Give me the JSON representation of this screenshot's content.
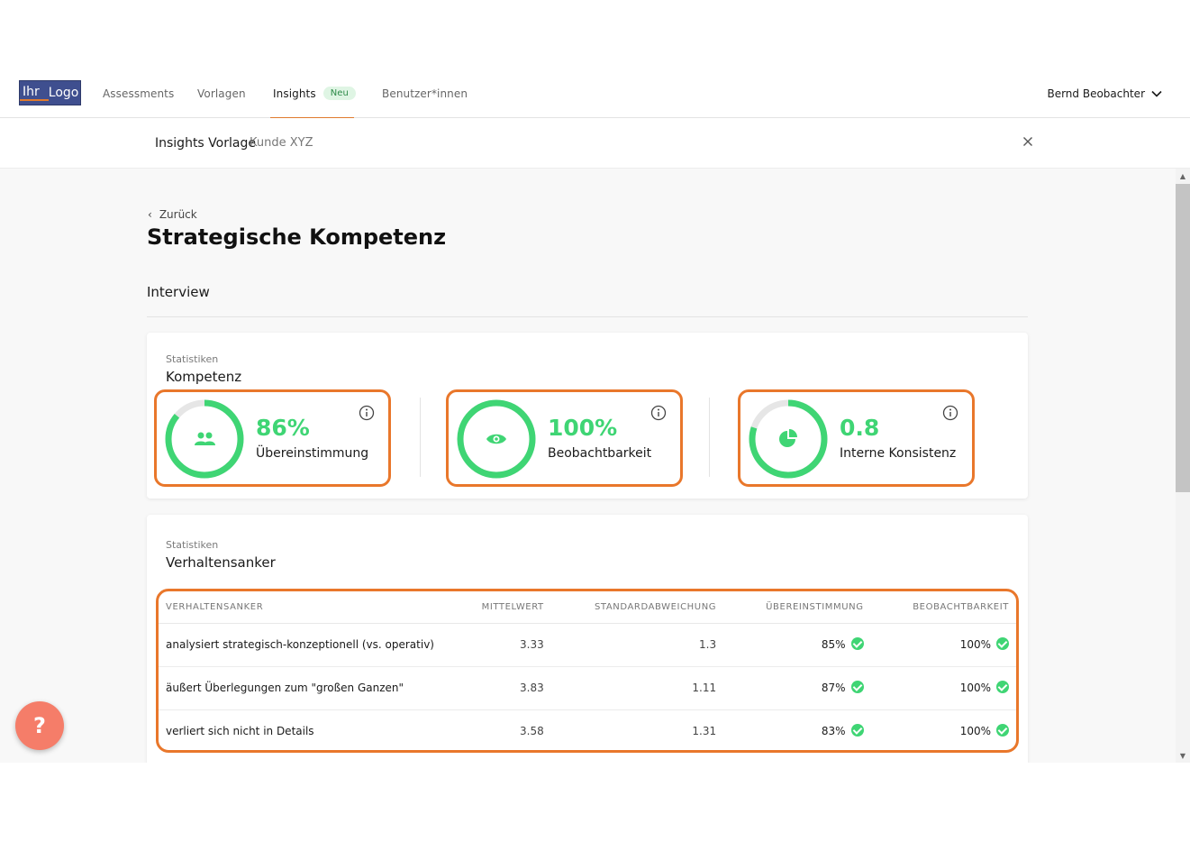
{
  "nav": {
    "logo_left": "Ihr",
    "logo_right": "Logo",
    "items": [
      {
        "label": "Assessments"
      },
      {
        "label": "Vorlagen"
      },
      {
        "label": "Insights",
        "badge": "Neu"
      },
      {
        "label": "Benutzer*innen"
      }
    ],
    "user": "Bernd Beobachter"
  },
  "subheader": {
    "title": "Insights Vorlage",
    "subtitle": "Kunde XYZ"
  },
  "page": {
    "back_label": "Zurück",
    "title": "Strategische Kompetenz",
    "section": "Interview"
  },
  "competence_card": {
    "small_label": "Statistiken",
    "title": "Kompetenz",
    "stats": [
      {
        "value": "86%",
        "label": "Übereinstimmung",
        "icon": "people-icon",
        "fill": 0.86
      },
      {
        "value": "100%",
        "label": "Beobachtbarkeit",
        "icon": "eye-icon",
        "fill": 1.0
      },
      {
        "value": "0.8",
        "label": "Interne Konsistenz",
        "icon": "pie-icon",
        "fill": 0.8
      }
    ]
  },
  "anchors_card": {
    "small_label": "Statistiken",
    "title": "Verhaltensanker",
    "columns": [
      "VERHALTENSANKER",
      "MITTELWERT",
      "STANDARDABWEICHUNG",
      "ÜBEREINSTIMMUNG",
      "BEOBACHTBARKEIT"
    ],
    "rows": [
      {
        "anker": "analysiert strategisch-konzeptionell (vs. operativ)",
        "mittelwert": "3.33",
        "std": "1.3",
        "ueber": "85%",
        "beob": "100%"
      },
      {
        "anker": "äußert Überlegungen zum \"großen Ganzen\"",
        "mittelwert": "3.83",
        "std": "1.11",
        "ueber": "87%",
        "beob": "100%"
      },
      {
        "anker": "verliert sich nicht in Details",
        "mittelwert": "3.58",
        "std": "1.31",
        "ueber": "83%",
        "beob": "100%"
      }
    ]
  },
  "help_label": "?",
  "colors": {
    "accent": "#e9772b",
    "green": "#3fd574",
    "track": "#e6e6e6"
  }
}
